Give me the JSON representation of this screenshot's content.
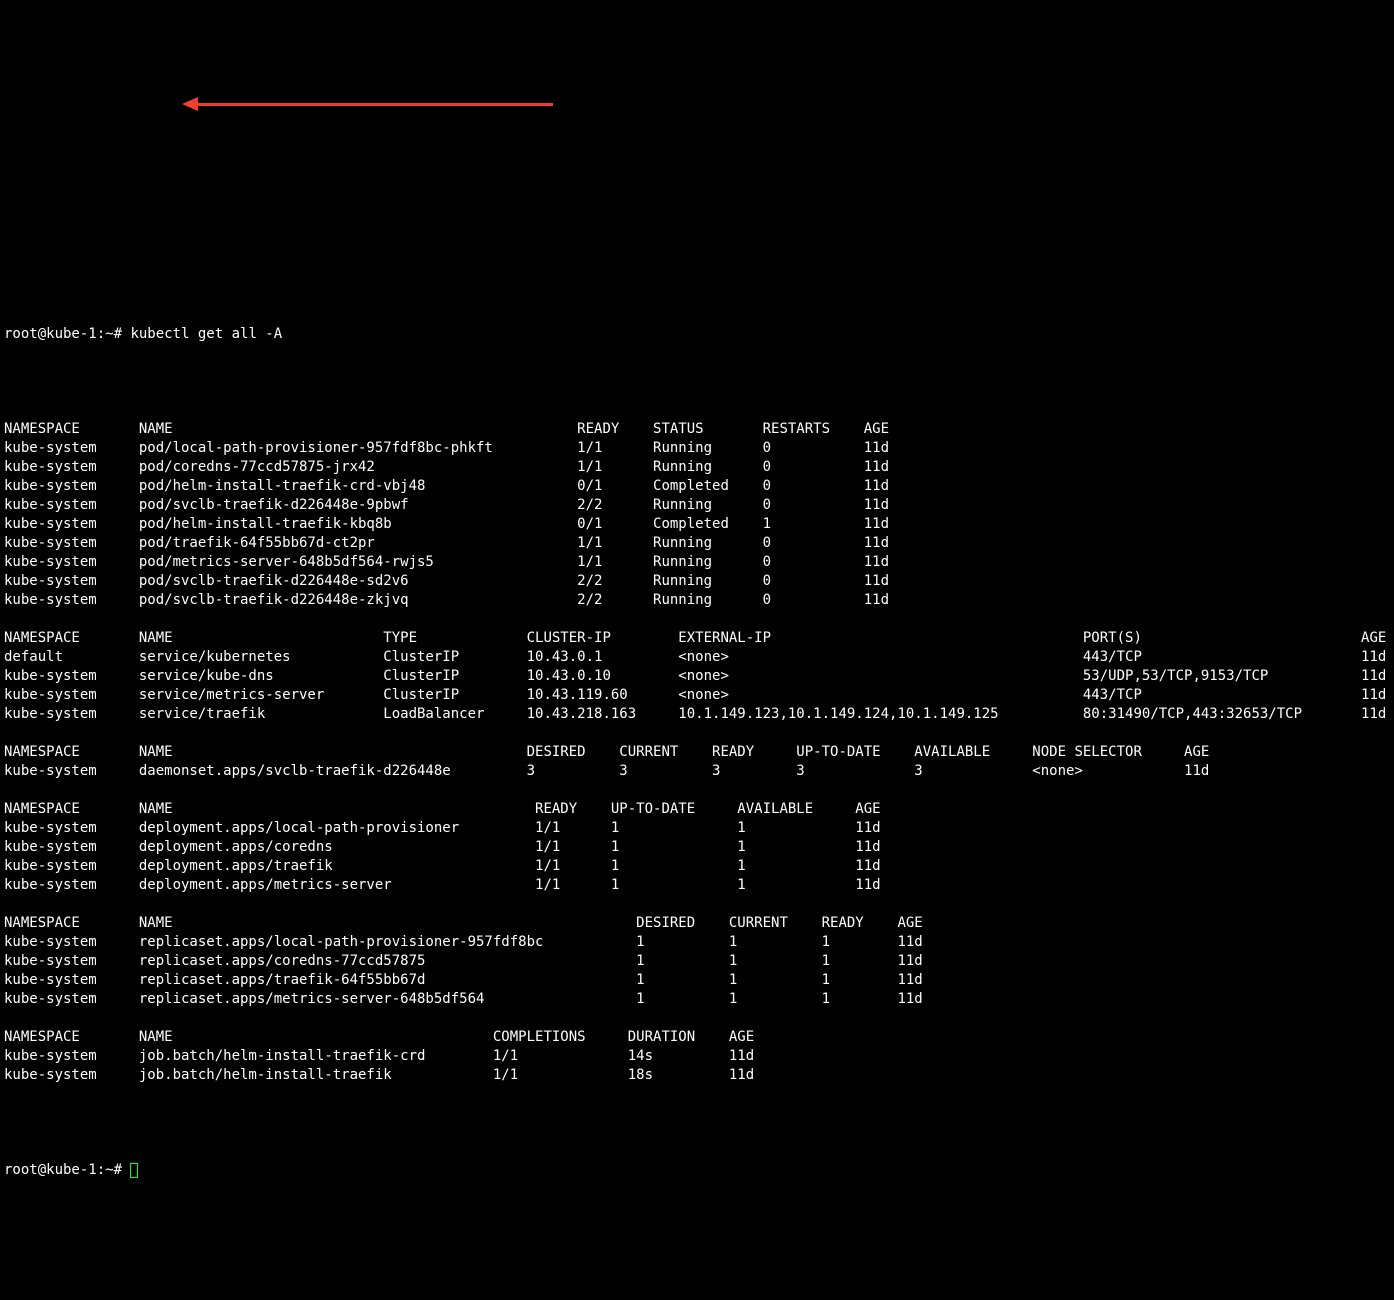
{
  "prompt1": "root@kube-1:~# ",
  "command": "kubectl get all -A",
  "prompt2": "root@kube-1:~# ",
  "sections": {
    "pods": {
      "headers": [
        "NAMESPACE",
        "NAME",
        "READY",
        "STATUS",
        "RESTARTS",
        "AGE"
      ],
      "rows": [
        {
          "namespace": "kube-system",
          "name": "pod/local-path-provisioner-957fdf8bc-phkft",
          "ready": "1/1",
          "status": "Running",
          "restarts": "0",
          "age": "11d"
        },
        {
          "namespace": "kube-system",
          "name": "pod/coredns-77ccd57875-jrx42",
          "ready": "1/1",
          "status": "Running",
          "restarts": "0",
          "age": "11d"
        },
        {
          "namespace": "kube-system",
          "name": "pod/helm-install-traefik-crd-vbj48",
          "ready": "0/1",
          "status": "Completed",
          "restarts": "0",
          "age": "11d"
        },
        {
          "namespace": "kube-system",
          "name": "pod/svclb-traefik-d226448e-9pbwf",
          "ready": "2/2",
          "status": "Running",
          "restarts": "0",
          "age": "11d"
        },
        {
          "namespace": "kube-system",
          "name": "pod/helm-install-traefik-kbq8b",
          "ready": "0/1",
          "status": "Completed",
          "restarts": "1",
          "age": "11d"
        },
        {
          "namespace": "kube-system",
          "name": "pod/traefik-64f55bb67d-ct2pr",
          "ready": "1/1",
          "status": "Running",
          "restarts": "0",
          "age": "11d"
        },
        {
          "namespace": "kube-system",
          "name": "pod/metrics-server-648b5df564-rwjs5",
          "ready": "1/1",
          "status": "Running",
          "restarts": "0",
          "age": "11d"
        },
        {
          "namespace": "kube-system",
          "name": "pod/svclb-traefik-d226448e-sd2v6",
          "ready": "2/2",
          "status": "Running",
          "restarts": "0",
          "age": "11d"
        },
        {
          "namespace": "kube-system",
          "name": "pod/svclb-traefik-d226448e-zkjvq",
          "ready": "2/2",
          "status": "Running",
          "restarts": "0",
          "age": "11d"
        }
      ]
    },
    "services": {
      "headers": [
        "NAMESPACE",
        "NAME",
        "TYPE",
        "CLUSTER-IP",
        "EXTERNAL-IP",
        "PORT(S)",
        "AGE"
      ],
      "rows": [
        {
          "namespace": "default",
          "name": "service/kubernetes",
          "type": "ClusterIP",
          "clusterip": "10.43.0.1",
          "externalip": "<none>",
          "ports": "443/TCP",
          "age": "11d"
        },
        {
          "namespace": "kube-system",
          "name": "service/kube-dns",
          "type": "ClusterIP",
          "clusterip": "10.43.0.10",
          "externalip": "<none>",
          "ports": "53/UDP,53/TCP,9153/TCP",
          "age": "11d"
        },
        {
          "namespace": "kube-system",
          "name": "service/metrics-server",
          "type": "ClusterIP",
          "clusterip": "10.43.119.60",
          "externalip": "<none>",
          "ports": "443/TCP",
          "age": "11d"
        },
        {
          "namespace": "kube-system",
          "name": "service/traefik",
          "type": "LoadBalancer",
          "clusterip": "10.43.218.163",
          "externalip": "10.1.149.123,10.1.149.124,10.1.149.125",
          "ports": "80:31490/TCP,443:32653/TCP",
          "age": "11d"
        }
      ]
    },
    "daemonsets": {
      "headers": [
        "NAMESPACE",
        "NAME",
        "DESIRED",
        "CURRENT",
        "READY",
        "UP-TO-DATE",
        "AVAILABLE",
        "NODE SELECTOR",
        "AGE"
      ],
      "rows": [
        {
          "namespace": "kube-system",
          "name": "daemonset.apps/svclb-traefik-d226448e",
          "desired": "3",
          "current": "3",
          "ready": "3",
          "uptodate": "3",
          "available": "3",
          "nodeselector": "<none>",
          "age": "11d"
        }
      ]
    },
    "deployments": {
      "headers": [
        "NAMESPACE",
        "NAME",
        "READY",
        "UP-TO-DATE",
        "AVAILABLE",
        "AGE"
      ],
      "rows": [
        {
          "namespace": "kube-system",
          "name": "deployment.apps/local-path-provisioner",
          "ready": "1/1",
          "uptodate": "1",
          "available": "1",
          "age": "11d"
        },
        {
          "namespace": "kube-system",
          "name": "deployment.apps/coredns",
          "ready": "1/1",
          "uptodate": "1",
          "available": "1",
          "age": "11d"
        },
        {
          "namespace": "kube-system",
          "name": "deployment.apps/traefik",
          "ready": "1/1",
          "uptodate": "1",
          "available": "1",
          "age": "11d"
        },
        {
          "namespace": "kube-system",
          "name": "deployment.apps/metrics-server",
          "ready": "1/1",
          "uptodate": "1",
          "available": "1",
          "age": "11d"
        }
      ]
    },
    "replicasets": {
      "headers": [
        "NAMESPACE",
        "NAME",
        "DESIRED",
        "CURRENT",
        "READY",
        "AGE"
      ],
      "rows": [
        {
          "namespace": "kube-system",
          "name": "replicaset.apps/local-path-provisioner-957fdf8bc",
          "desired": "1",
          "current": "1",
          "ready": "1",
          "age": "11d"
        },
        {
          "namespace": "kube-system",
          "name": "replicaset.apps/coredns-77ccd57875",
          "desired": "1",
          "current": "1",
          "ready": "1",
          "age": "11d"
        },
        {
          "namespace": "kube-system",
          "name": "replicaset.apps/traefik-64f55bb67d",
          "desired": "1",
          "current": "1",
          "ready": "1",
          "age": "11d"
        },
        {
          "namespace": "kube-system",
          "name": "replicaset.apps/metrics-server-648b5df564",
          "desired": "1",
          "current": "1",
          "ready": "1",
          "age": "11d"
        }
      ]
    },
    "jobs": {
      "headers": [
        "NAMESPACE",
        "NAME",
        "COMPLETIONS",
        "DURATION",
        "AGE"
      ],
      "rows": [
        {
          "namespace": "kube-system",
          "name": "job.batch/helm-install-traefik-crd",
          "completions": "1/1",
          "duration": "14s",
          "age": "11d"
        },
        {
          "namespace": "kube-system",
          "name": "job.batch/helm-install-traefik",
          "completions": "1/1",
          "duration": "18s",
          "age": "11d"
        }
      ]
    }
  },
  "blank": "                                                                                                    "
}
